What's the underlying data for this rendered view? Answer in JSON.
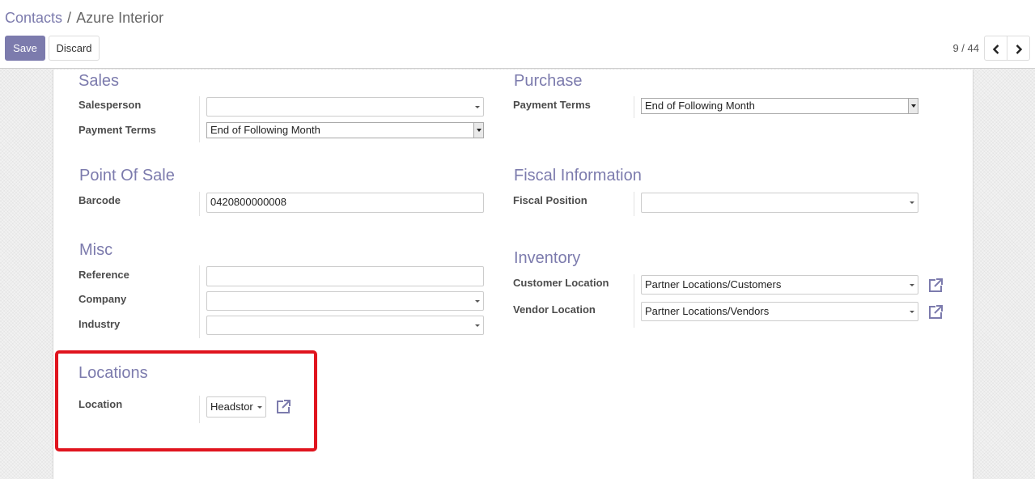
{
  "breadcrumb": {
    "parent": "Contacts",
    "separator": "/",
    "current": "Azure Interior"
  },
  "buttons": {
    "save": "Save",
    "discard": "Discard"
  },
  "pager": {
    "value": "9 / 44"
  },
  "icons": {
    "prev": "chevron-left-icon",
    "next": "chevron-right-icon",
    "external": "external-link-icon"
  },
  "colors": {
    "accent": "#7c7bad",
    "highlight": "#e0141e"
  },
  "sales": {
    "title": "Sales",
    "salesperson_label": "Salesperson",
    "salesperson_value": "",
    "payment_terms_label": "Payment Terms",
    "payment_terms_value": "End of Following Month"
  },
  "purchase": {
    "title": "Purchase",
    "payment_terms_label": "Payment Terms",
    "payment_terms_value": "End of Following Month"
  },
  "pos": {
    "title": "Point Of Sale",
    "barcode_label": "Barcode",
    "barcode_value": "0420800000008"
  },
  "fiscal": {
    "title": "Fiscal Information",
    "position_label": "Fiscal Position",
    "position_value": ""
  },
  "misc": {
    "title": "Misc",
    "reference_label": "Reference",
    "reference_value": "",
    "company_label": "Company",
    "company_value": "",
    "industry_label": "Industry",
    "industry_value": ""
  },
  "inventory": {
    "title": "Inventory",
    "customer_label": "Customer Location",
    "customer_value": "Partner Locations/Customers",
    "vendor_label": "Vendor Location",
    "vendor_value": "Partner Locations/Vendors"
  },
  "locations": {
    "title": "Locations",
    "location_label": "Location",
    "location_value": "Headstor"
  }
}
